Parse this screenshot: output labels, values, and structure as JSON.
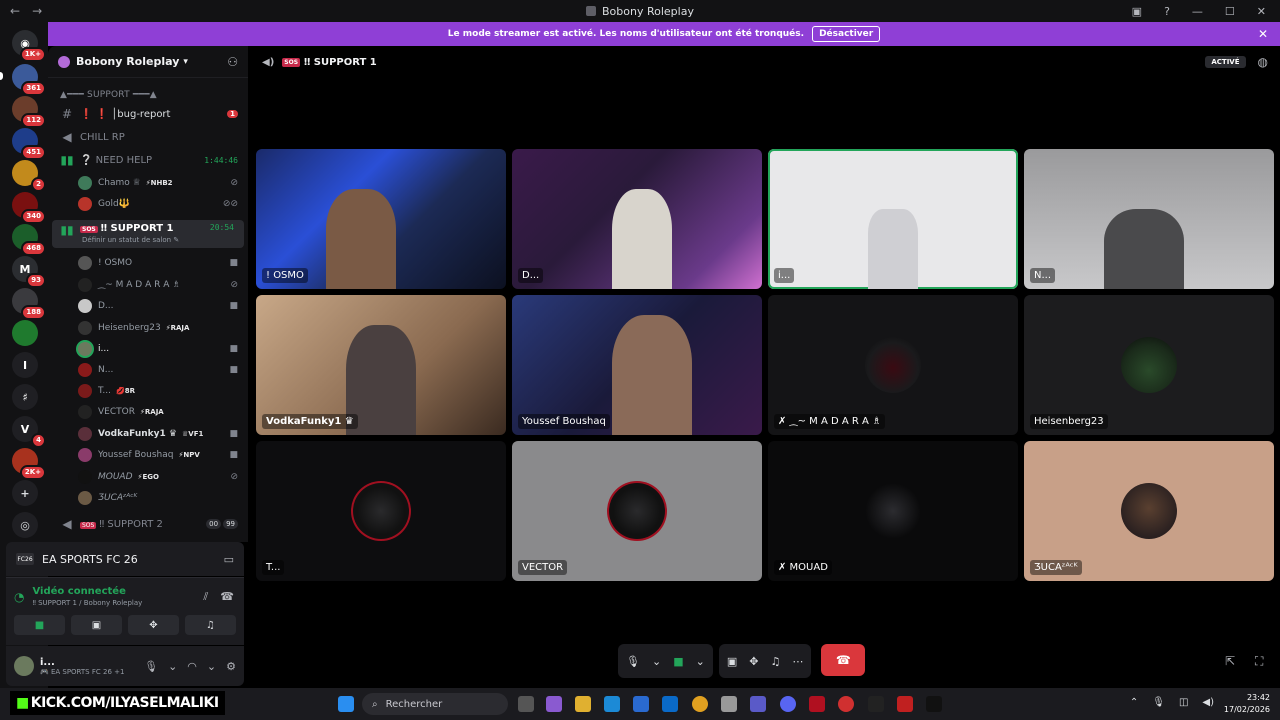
{
  "window": {
    "title": "Bobony Roleplay",
    "back": "←",
    "forward": "→"
  },
  "banner": {
    "text": "Le mode streamer est activé. Les noms d'utilisateur ont été tronqués.",
    "button": "Désactiver"
  },
  "server_rail": {
    "badges": [
      "1K+",
      "361",
      "112",
      "451",
      "2",
      "340",
      "468",
      "93",
      "188",
      "4",
      "2K+"
    ]
  },
  "guild": {
    "name": "Bobony Roleplay"
  },
  "sidebar": {
    "category": "▲━━━ SUPPORT ━━━▲",
    "bug_report": {
      "name": "❗ ❗ │bug-report",
      "badge": "1"
    },
    "chill": "CHILL RP",
    "need_help": {
      "name": "NEED HELP",
      "time": "1:44:46"
    },
    "need_help_members": [
      {
        "name": "Chamo ♕",
        "tag": "⚡NHB2"
      },
      {
        "name": "Gold🔱",
        "tag": ""
      }
    ],
    "support1": {
      "tag": "SOS",
      "name": "‼ SUPPORT 1",
      "time": "20:54",
      "sub": "Définir un statut de salon ✎"
    },
    "support1_members": [
      {
        "name": "! OSMO",
        "tag": ""
      },
      {
        "name": "⁔~ M A D A R A ♗",
        "tag": ""
      },
      {
        "name": "D...",
        "tag": ""
      },
      {
        "name": "Heisenberg23",
        "tag": "⚡RAJA"
      },
      {
        "name": "i...",
        "tag": ""
      },
      {
        "name": "N...",
        "tag": ""
      },
      {
        "name": "T...",
        "tag": "💋8R"
      },
      {
        "name": "VECTOR",
        "tag": "⚡RAJA"
      },
      {
        "name": "VodkaFunky1 ♛",
        "tag": "♕VF1"
      },
      {
        "name": "Youssef Boushaq",
        "tag": "⚡NPV"
      },
      {
        "name": "MOUAD",
        "tag": "⚡EGO"
      },
      {
        "name": "ƷUCAᶻᴬᶜᴷ",
        "tag": ""
      }
    ],
    "support2": {
      "tag": "SOS",
      "name": "‼ SUPPORT 2",
      "c1": "00",
      "c2": "99"
    }
  },
  "activity": {
    "game": "EA SPORTS FC 26",
    "logo": "FC26"
  },
  "voice": {
    "status": "Vidéo connectée",
    "location": "‼ SUPPORT 1 / Bobony Roleplay"
  },
  "user": {
    "name": "i...",
    "status": "🎮 EA SPORTS FC 26 +1"
  },
  "header": {
    "tag": "SOS",
    "channel": "‼ SUPPORT 1",
    "activity_badge": "ACTIVÉ"
  },
  "tiles": [
    {
      "label": "! OSMO"
    },
    {
      "label": "D..."
    },
    {
      "label": "i..."
    },
    {
      "label": "N..."
    },
    {
      "label": "VodkaFunky1 ♛"
    },
    {
      "label": "Youssef Boushaq"
    },
    {
      "label": "✗ ⁔~ M A D A R A ♗"
    },
    {
      "label": "Heisenberg23"
    },
    {
      "label": "T..."
    },
    {
      "label": "VECTOR"
    },
    {
      "label": "✗ MOUAD"
    },
    {
      "label": "ƷUCAᶻᴬᶜᴷ"
    }
  ],
  "taskbar": {
    "overlay": "KICK.COM/ILYASELMALIKI",
    "search": "Rechercher",
    "time": "23:42",
    "date": "17/02/2026"
  },
  "colors": {
    "banner": "#8f3fd6",
    "speaking": "#23a55a",
    "hangup": "#da373c",
    "kick": "#53fc18"
  }
}
